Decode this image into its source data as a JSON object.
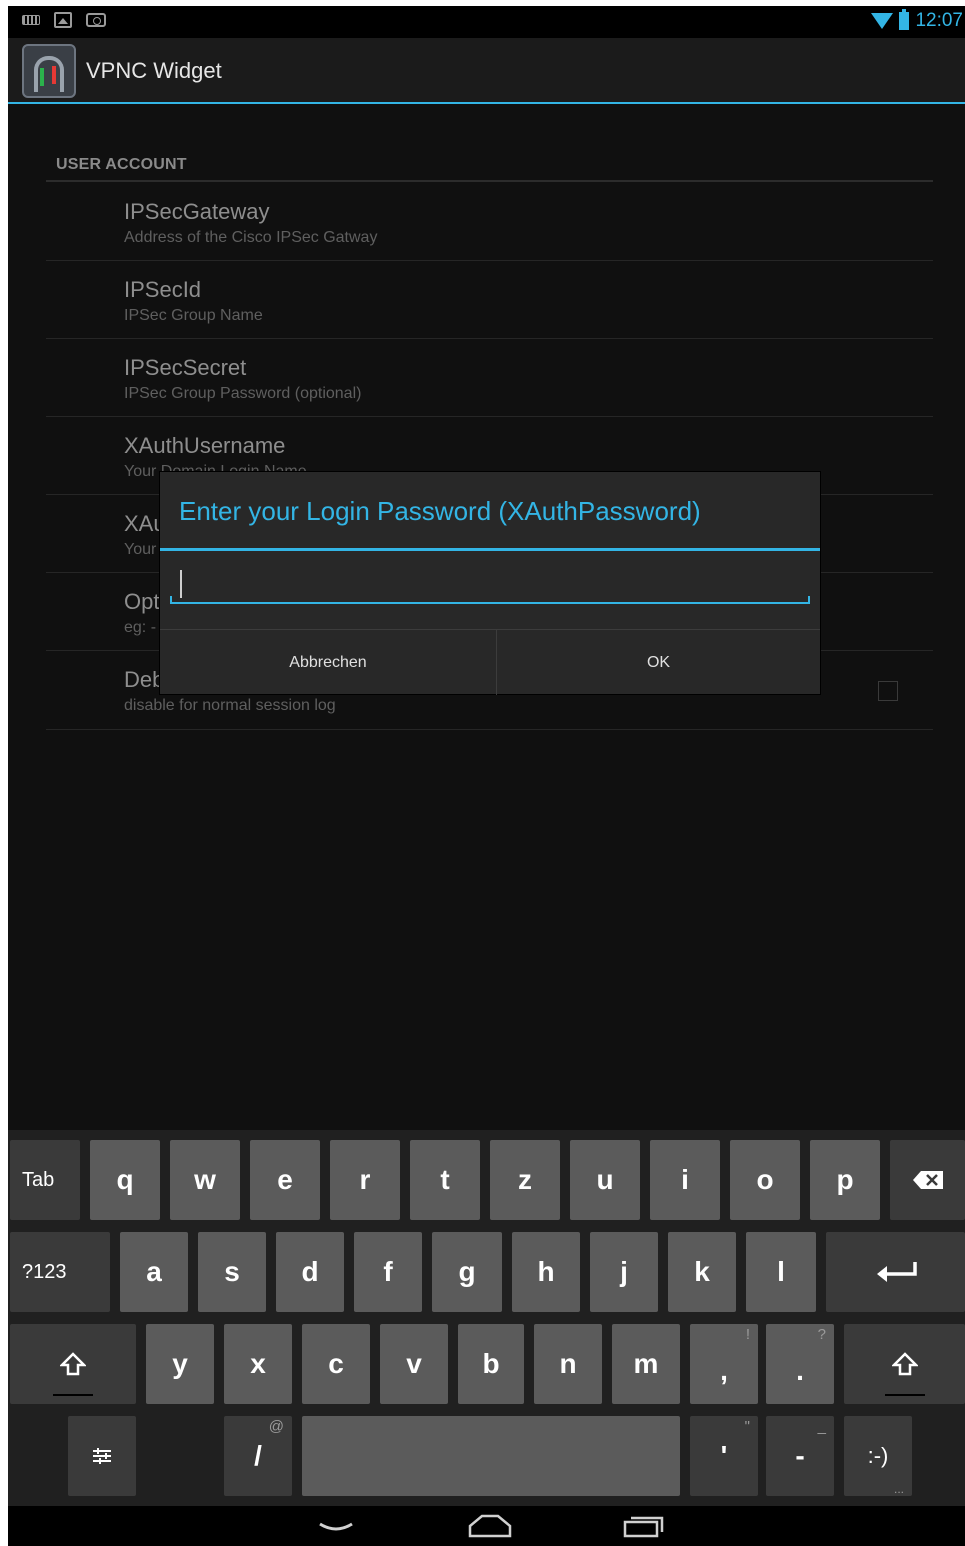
{
  "status_bar": {
    "time": "12:07",
    "icons": [
      "keyboard-icon",
      "image-icon",
      "camera-icon",
      "wifi-icon",
      "battery-icon"
    ]
  },
  "action_bar": {
    "title": "VPNC Widget",
    "icon": "vpnc-app-icon"
  },
  "section": {
    "header": "USER ACCOUNT"
  },
  "prefs": [
    {
      "title": "IPSecGateway",
      "summary": "Address of the Cisco IPSec Gatway"
    },
    {
      "title": "IPSecId",
      "summary": "IPSec Group Name"
    },
    {
      "title": "IPSecSecret",
      "summary": "IPSec Group Password (optional)"
    },
    {
      "title": "XAuthUsername",
      "summary": "Your Domain Login Name"
    },
    {
      "title": "XAu",
      "summary": "Your"
    },
    {
      "title": "Opti",
      "summary": "eg: -"
    },
    {
      "title": "Deb",
      "summary": "disable for normal session log"
    }
  ],
  "dialog": {
    "title": "Enter your Login Password (XAuthPassword)",
    "input_value": "",
    "cancel_label": "Abbrechen",
    "ok_label": "OK"
  },
  "keyboard": {
    "row1": [
      "q",
      "w",
      "e",
      "r",
      "t",
      "z",
      "u",
      "i",
      "o",
      "p"
    ],
    "row2": [
      "a",
      "s",
      "d",
      "f",
      "g",
      "h",
      "j",
      "k",
      "l"
    ],
    "row3": [
      "y",
      "x",
      "c",
      "v",
      "b",
      "n",
      "m"
    ],
    "tab_label": "Tab",
    "symbols_label": "?123",
    "comma": ",",
    "comma_hint": "!",
    "period": ".",
    "period_hint": "?",
    "slash": "/",
    "slash_hint": "@",
    "apostrophe": "'",
    "apostrophe_hint": "\"",
    "dash": "-",
    "dash_hint": "_",
    "smiley": ":-)",
    "smiley_hint": "..."
  },
  "colors": {
    "accent": "#33b5e5",
    "background": "#101010",
    "key": "#5b5b5b",
    "key_dark": "#3a3a3a"
  }
}
